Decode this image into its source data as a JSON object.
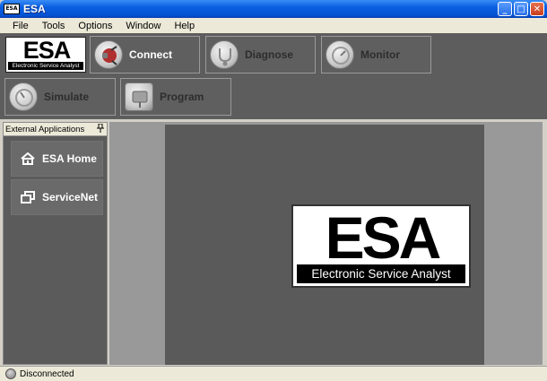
{
  "window": {
    "title": "ESA",
    "app_icon_text": "ESA",
    "controls": {
      "minimize": "_",
      "maximize": "□",
      "close": "✕"
    }
  },
  "menu": [
    "File",
    "Tools",
    "Options",
    "Window",
    "Help"
  ],
  "toolbar": {
    "logo": {
      "main": "ESA",
      "sub": "Electronic Service Analyst"
    },
    "buttons": [
      {
        "label": "Connect",
        "icon": "connector-plug-icon",
        "state": "active"
      },
      {
        "label": "Diagnose",
        "icon": "stethoscope-icon",
        "state": "disabled"
      },
      {
        "label": "Monitor",
        "icon": "gauge-icon",
        "state": "disabled"
      },
      {
        "label": "Simulate",
        "icon": "dial-icon",
        "state": "disabled"
      },
      {
        "label": "Program",
        "icon": "chip-icon",
        "state": "disabled"
      }
    ]
  },
  "left_panel": {
    "header": "External Applications",
    "pin_icon": "pin-icon",
    "items": [
      {
        "label": "ESA Home",
        "icon": "home-icon"
      },
      {
        "label": "ServiceNet",
        "icon": "windows-icon"
      }
    ]
  },
  "main": {
    "logo": {
      "main": "ESA",
      "sub": "Electronic Service Analyst"
    }
  },
  "status": {
    "text": "Disconnected",
    "indicator_color": "#8a8a8a"
  },
  "colors": {
    "titlebar": "#0353d4",
    "toolbar_bg": "#5d5d5d",
    "main_bg": "#5a5a5a",
    "frame_bg": "#999999"
  }
}
